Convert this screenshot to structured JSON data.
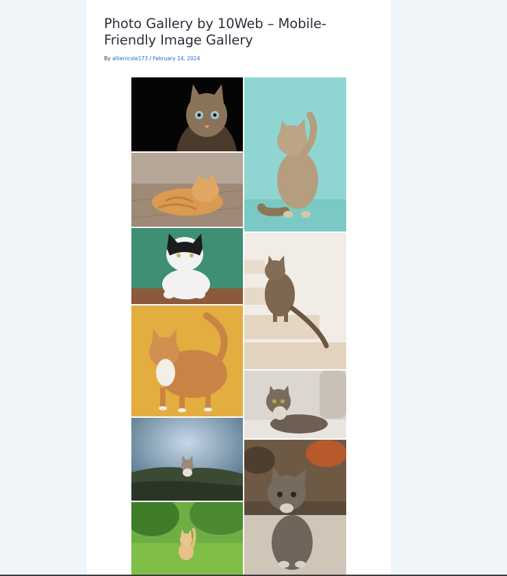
{
  "post": {
    "title": "Photo Gallery by 10Web – Mobile-Friendly Image Gallery",
    "by_label": "By",
    "author": "allienicole173",
    "separator": "/",
    "date": "February 14, 2024"
  },
  "gallery": {
    "images": [
      {
        "id": "cat-dark-portrait",
        "bg": "#050505",
        "fur": "#8a7358"
      },
      {
        "id": "cat-ginger-lying-floor",
        "bg": "#a8998a",
        "fur": "#d99a52"
      },
      {
        "id": "cat-black-white-green",
        "bg": "#3e8f74",
        "fur": "#f2f2f2"
      },
      {
        "id": "cat-ginger-yellow-bg",
        "bg": "#e3ad3f",
        "fur": "#c98445"
      },
      {
        "id": "cat-kitten-blue-field",
        "bg": "#7fa0bb",
        "fur": "#9b8a7a"
      },
      {
        "id": "cat-kitten-green-grass",
        "bg": "#6fae45",
        "fur": "#e7c08a"
      },
      {
        "id": "cat-kitten-teal-paw",
        "bg": "#8fd6d2",
        "fur": "#b49e7d"
      },
      {
        "id": "cat-tabby-stairs",
        "bg": "#f1ece6",
        "fur": "#7c6650"
      },
      {
        "id": "cat-tabby-sofa",
        "bg": "#dcd6d0",
        "fur": "#6d5f52"
      },
      {
        "id": "cat-kitten-tabby-ground",
        "bg": "#cfc6b8",
        "fur": "#6f655a"
      }
    ]
  }
}
